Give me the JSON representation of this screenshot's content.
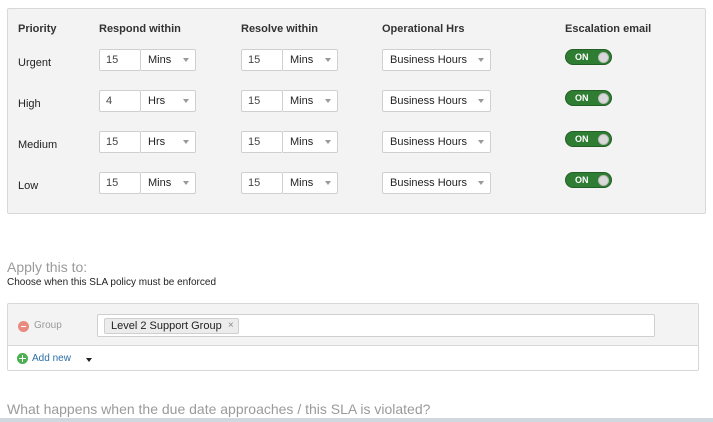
{
  "sla_table": {
    "headers": {
      "priority": "Priority",
      "respond": "Respond within",
      "resolve": "Resolve within",
      "hours": "Operational Hrs",
      "escalation": "Escalation email"
    },
    "rows": [
      {
        "priority": "Urgent",
        "respond_value": "15",
        "respond_unit": "Mins",
        "resolve_value": "15",
        "resolve_unit": "Mins",
        "hours": "Business Hours",
        "escalation": "ON"
      },
      {
        "priority": "High",
        "respond_value": "4",
        "respond_unit": "Hrs",
        "resolve_value": "15",
        "resolve_unit": "Mins",
        "hours": "Business Hours",
        "escalation": "ON"
      },
      {
        "priority": "Medium",
        "respond_value": "15",
        "respond_unit": "Hrs",
        "resolve_value": "15",
        "resolve_unit": "Mins",
        "hours": "Business Hours",
        "escalation": "ON"
      },
      {
        "priority": "Low",
        "respond_value": "15",
        "respond_unit": "Mins",
        "resolve_value": "15",
        "resolve_unit": "Mins",
        "hours": "Business Hours",
        "escalation": "ON"
      }
    ]
  },
  "apply": {
    "title": "Apply this to:",
    "subtitle": "Choose when this SLA policy must be enforced",
    "condition": {
      "field": "Group",
      "tag": "Level 2 Support Group",
      "tag_remove": "×"
    },
    "add_new": "Add new"
  },
  "footer": {
    "question": "What happens when the due date approaches / this SLA is violated?"
  },
  "colors": {
    "toggle_on": "#2e7d32",
    "link": "#2a6ea6",
    "remove": "#e88a80",
    "add": "#4caf50"
  },
  "icons": [
    "chevron-down-icon",
    "remove-circle-icon",
    "add-circle-icon",
    "toggle-knob-icon",
    "close-icon"
  ]
}
